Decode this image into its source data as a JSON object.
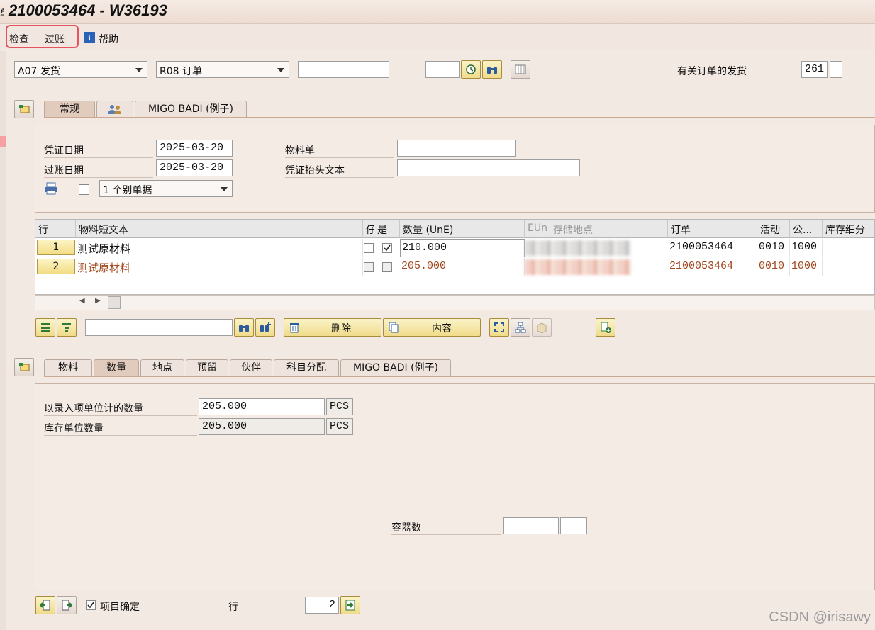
{
  "window": {
    "title_prefix": "单",
    "title": "2100053464 - W36193"
  },
  "menu": {
    "check": "检查",
    "post": "过账",
    "help": "帮助"
  },
  "header": {
    "action": "A07 发货",
    "reference": "R08 订单",
    "order_input": "",
    "small_input": "",
    "related_label": "有关订单的发货",
    "movement_type": "261",
    "movement_type2": ""
  },
  "header_tabs": [
    {
      "label": "常规"
    },
    {
      "label": ""
    },
    {
      "label": "MIGO BADI (例子)"
    }
  ],
  "general": {
    "doc_date_label": "凭证日期",
    "doc_date": "2025-03-20",
    "post_date_label": "过账日期",
    "post_date": "2025-03-20",
    "material_slip_label": "物料单",
    "material_slip": "",
    "header_text_label": "凭证抬头文本",
    "header_text": "",
    "print_option": "1 个别单据"
  },
  "grid": {
    "headers": [
      "行",
      "物料短文本",
      "仔",
      "是",
      "数量 (UnE)",
      "EUn",
      "存储地点",
      "订单",
      "活动",
      "公...",
      "库存细分"
    ],
    "rows": [
      {
        "line": "1",
        "text": "测试原材料",
        "ok": false,
        "chosen": true,
        "qty": "210.000",
        "order": "2100053464",
        "activity": "0010",
        "plant": "1000"
      },
      {
        "line": "2",
        "text": "测试原材料",
        "ok": false,
        "chosen": false,
        "qty": "205.000",
        "order": "2100053464",
        "activity": "0010",
        "plant": "1000"
      }
    ]
  },
  "toolbar": {
    "search_input": "",
    "delete_label": "删除",
    "content_label": "内容"
  },
  "item_tabs": [
    {
      "label": "物料"
    },
    {
      "label": "数量"
    },
    {
      "label": "地点"
    },
    {
      "label": "预留"
    },
    {
      "label": "伙伴"
    },
    {
      "label": "科目分配"
    },
    {
      "label": "MIGO BADI (例子)"
    }
  ],
  "quantity": {
    "entry_label": "以录入项单位计的数量",
    "entry_value": "205.000",
    "entry_unit": "PCS",
    "stock_label": "库存单位数量",
    "stock_value": "205.000",
    "stock_unit": "PCS",
    "containers_label": "容器数",
    "containers_value": "",
    "containers_unit": ""
  },
  "footer": {
    "item_ok_label": "项目确定",
    "line_label": "行",
    "line_value": "2"
  },
  "watermark": "CSDN @irisawy",
  "colors": {
    "background": "#f3e9e3",
    "button": "#f2dc84",
    "highlight": "#e8525f",
    "row2_text": "#a0461c"
  }
}
